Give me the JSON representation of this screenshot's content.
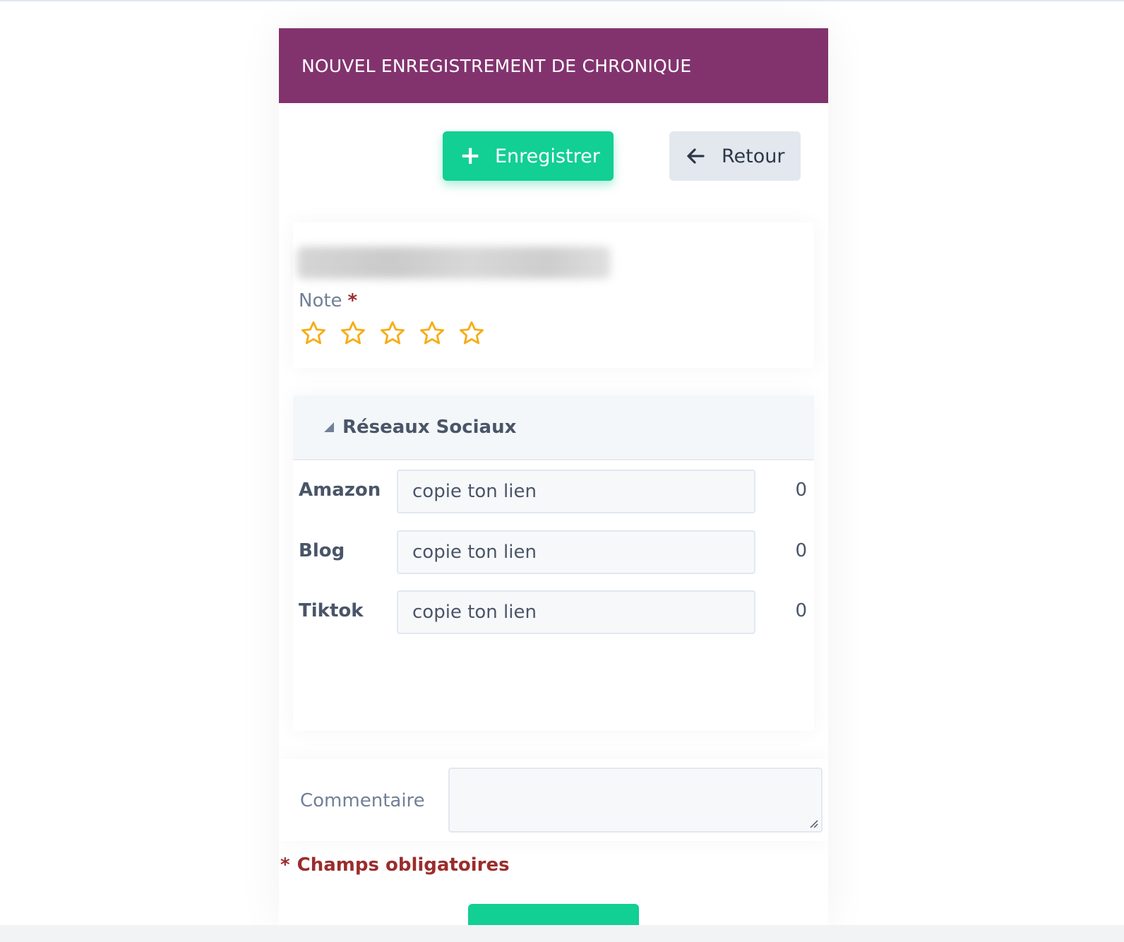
{
  "header": {
    "title": "NOUVEL ENREGISTREMENT DE CHRONIQUE"
  },
  "toolbar": {
    "save_label": "Enregistrer",
    "save_icon": "plus-icon",
    "back_label": "Retour",
    "back_icon": "arrow-left-icon"
  },
  "note": {
    "label": "Note",
    "required_mark": "*",
    "rating": 0,
    "max_rating": 5,
    "star_color": "#f6ad19"
  },
  "social": {
    "title": "Réseaux Sociaux",
    "rows": [
      {
        "label": "Amazon",
        "placeholder": "copie ton lien",
        "count": "0"
      },
      {
        "label": "Blog",
        "placeholder": "copie ton lien",
        "count": "0"
      },
      {
        "label": "Tiktok",
        "placeholder": "copie ton lien",
        "count": "0"
      }
    ]
  },
  "comment": {
    "label": "Commentaire",
    "value": ""
  },
  "footer": {
    "required_mark": "*",
    "required_text": "Champs obligatoires"
  },
  "colors": {
    "header_bg": "#82336e",
    "primary": "#12cf93",
    "secondary_bg": "#e2e8ee",
    "required": "#9b2c2c"
  }
}
